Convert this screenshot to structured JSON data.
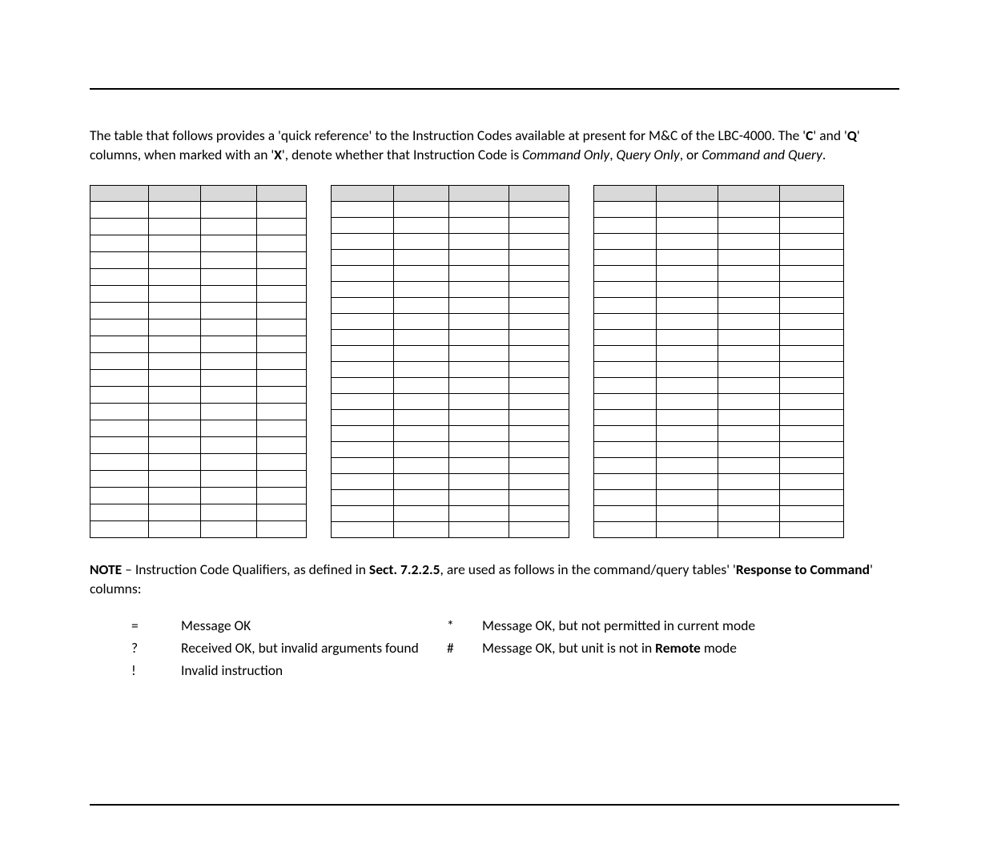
{
  "intro": {
    "pre": "The table that follows provides a 'quick reference' to the Instruction Codes available at present for M&C of the LBC-4000. The '",
    "c": "C",
    "mid1": "' and '",
    "q": "Q",
    "mid2": "' columns, when marked with an '",
    "x": "X",
    "mid3": "', denote whether that Instruction Code is ",
    "cmdonly": "Command Only",
    "comma1": ", ",
    "qryonly": "Query Only",
    "comma2": ", or ",
    "cmdqry": "Command and Query",
    "end": "."
  },
  "tables": {
    "t1_rows": 21,
    "t2_rows": 22,
    "t3_rows": 22
  },
  "note": {
    "label": "NOTE",
    "dash": " – Instruction Code Qualifiers, as defined in ",
    "sect": "Sect. 7.2.2.5",
    "mid": ", are used as follows in the command/query tables' '",
    "resp": "Response to Command",
    "end": "' columns:"
  },
  "qualifiers": {
    "r1s1": "=",
    "r1d1": "Message OK",
    "r1s2": "*",
    "r1d2": "Message OK, but not permitted in current mode",
    "r2s1": "?",
    "r2d1": "Received OK, but invalid arguments found",
    "r2s2": "#",
    "r2d2a": "Message OK, but unit is not in ",
    "r2d2b": "Remote",
    "r2d2c": " mode",
    "r3s1": "!",
    "r3d1": "Invalid instruction"
  }
}
